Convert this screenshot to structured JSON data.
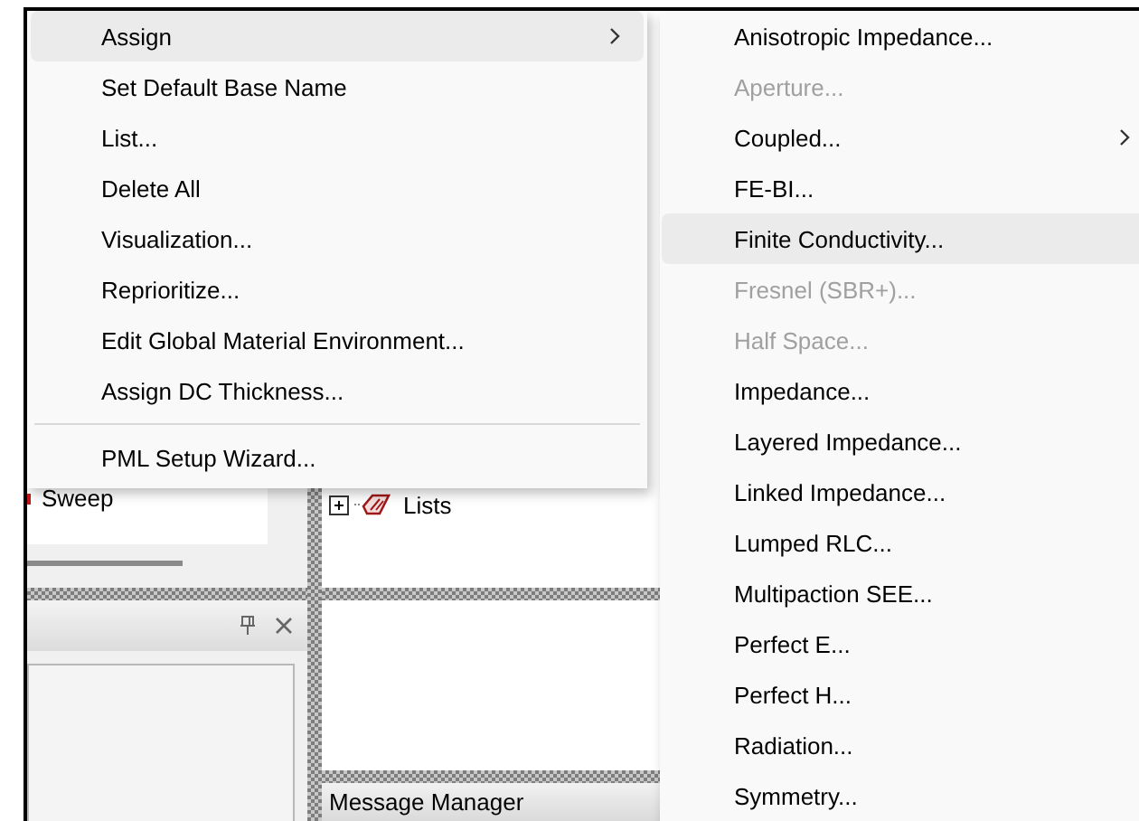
{
  "background": {
    "model_tree": {
      "items": [
        {
          "label": "Sweep"
        }
      ]
    },
    "project_tree": {
      "items": [
        {
          "label": "Lists",
          "expanded": false
        }
      ]
    },
    "properties_panel": {
      "pinned": false
    },
    "message_panel": {
      "title": "Message Manager"
    }
  },
  "context_menu": {
    "groups": [
      [
        {
          "label": "Assign",
          "has_submenu": true,
          "selected": true
        },
        {
          "label": "Set Default Base Name",
          "has_submenu": false,
          "selected": false
        },
        {
          "label": "List...",
          "has_submenu": false,
          "selected": false
        },
        {
          "label": "Delete All",
          "has_submenu": false,
          "selected": false
        },
        {
          "label": "Visualization...",
          "has_submenu": false,
          "selected": false
        },
        {
          "label": "Reprioritize...",
          "has_submenu": false,
          "selected": false
        },
        {
          "label": "Edit Global Material Environment...",
          "has_submenu": false,
          "selected": false
        },
        {
          "label": "Assign DC Thickness...",
          "has_submenu": false,
          "selected": false
        }
      ],
      [
        {
          "label": "PML Setup Wizard...",
          "has_submenu": false,
          "selected": false
        }
      ]
    ]
  },
  "submenu": {
    "items": [
      {
        "label": "Anisotropic Impedance...",
        "disabled": false,
        "has_submenu": false,
        "selected": false
      },
      {
        "label": "Aperture...",
        "disabled": true,
        "has_submenu": false,
        "selected": false
      },
      {
        "label": "Coupled...",
        "disabled": false,
        "has_submenu": true,
        "selected": false
      },
      {
        "label": "FE-BI...",
        "disabled": false,
        "has_submenu": false,
        "selected": false
      },
      {
        "label": "Finite Conductivity...",
        "disabled": false,
        "has_submenu": false,
        "selected": true
      },
      {
        "label": "Fresnel (SBR+)...",
        "disabled": true,
        "has_submenu": false,
        "selected": false
      },
      {
        "label": "Half Space...",
        "disabled": true,
        "has_submenu": false,
        "selected": false
      },
      {
        "label": "Impedance...",
        "disabled": false,
        "has_submenu": false,
        "selected": false
      },
      {
        "label": "Layered Impedance...",
        "disabled": false,
        "has_submenu": false,
        "selected": false
      },
      {
        "label": "Linked Impedance...",
        "disabled": false,
        "has_submenu": false,
        "selected": false
      },
      {
        "label": "Lumped RLC...",
        "disabled": false,
        "has_submenu": false,
        "selected": false
      },
      {
        "label": "Multipaction SEE...",
        "disabled": false,
        "has_submenu": false,
        "selected": false
      },
      {
        "label": "Perfect E...",
        "disabled": false,
        "has_submenu": false,
        "selected": false
      },
      {
        "label": "Perfect H...",
        "disabled": false,
        "has_submenu": false,
        "selected": false
      },
      {
        "label": "Radiation...",
        "disabled": false,
        "has_submenu": false,
        "selected": false
      },
      {
        "label": "Symmetry...",
        "disabled": false,
        "has_submenu": false,
        "selected": false
      }
    ]
  }
}
